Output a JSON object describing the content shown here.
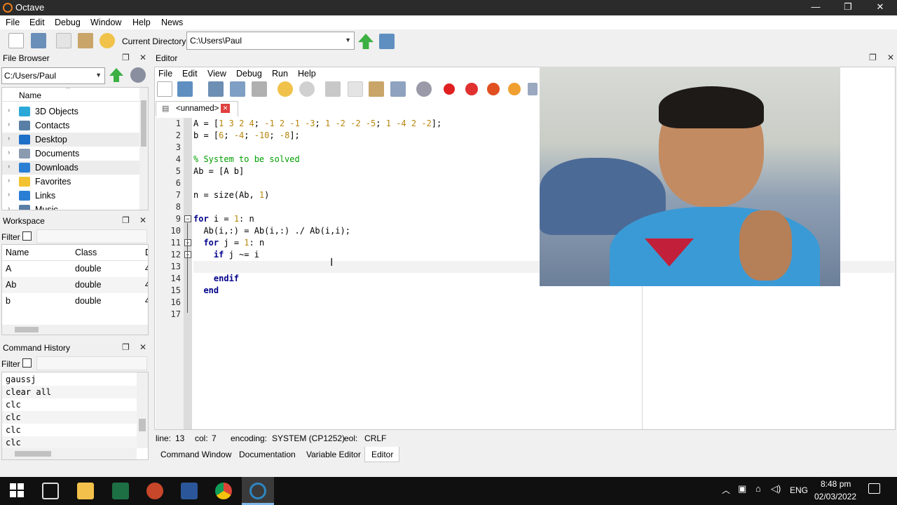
{
  "window": {
    "title": "Octave",
    "minimize": "—",
    "maximize": "❐",
    "close": "✕"
  },
  "menu": [
    "File",
    "Edit",
    "Debug",
    "Window",
    "Help",
    "News"
  ],
  "toolbar": {
    "current_dir_label": "Current Directory:",
    "current_dir_value": "C:\\Users\\Paul"
  },
  "file_browser": {
    "title": "File Browser",
    "path": "C:/Users/Paul",
    "column": "Name",
    "items": [
      {
        "label": "3D Objects",
        "icon": "3d-objects-icon",
        "color": "#2aa9d8"
      },
      {
        "label": "Contacts",
        "icon": "contacts-icon",
        "color": "#5a7fa6"
      },
      {
        "label": "Desktop",
        "icon": "desktop-icon",
        "color": "#1e6fc8"
      },
      {
        "label": "Documents",
        "icon": "documents-icon",
        "color": "#8a9bb0"
      },
      {
        "label": "Downloads",
        "icon": "downloads-icon",
        "color": "#2a7fd4"
      },
      {
        "label": "Favorites",
        "icon": "favorites-icon",
        "color": "#f2c230"
      },
      {
        "label": "Links",
        "icon": "links-icon",
        "color": "#2a7fd4"
      },
      {
        "label": "Music",
        "icon": "music-icon",
        "color": "#5a7fa6"
      }
    ]
  },
  "workspace": {
    "title": "Workspace",
    "filter_label": "Filter",
    "columns": [
      "Name",
      "Class",
      "D"
    ],
    "rows": [
      {
        "name": "A",
        "class": "double",
        "dim": "4"
      },
      {
        "name": "Ab",
        "class": "double",
        "dim": "4"
      },
      {
        "name": "b",
        "class": "double",
        "dim": "4"
      }
    ]
  },
  "history": {
    "title": "Command History",
    "filter_label": "Filter",
    "items": [
      "gaussj",
      "clear all",
      "clc",
      "clc",
      "clc",
      "clc"
    ]
  },
  "editor": {
    "title": "Editor",
    "menu": [
      "File",
      "Edit",
      "View",
      "Debug",
      "Run",
      "Help"
    ],
    "tab": "<unnamed>",
    "line_numbers": [
      "1",
      "2",
      "3",
      "4",
      "5",
      "6",
      "7",
      "8",
      "9",
      "10",
      "11",
      "12",
      "13",
      "14",
      "15",
      "16",
      "17"
    ],
    "lines": [
      "A = [1 3 2 4; -1 2 -1 -3; 1 -2 -2 -5; 1 -4 2 -2];",
      "b = [6; -4; -10; -8];",
      "",
      "% System to be solved",
      "Ab = [A b]",
      "",
      "n = size(Ab, 1)",
      "",
      "for i = 1: n",
      "  Ab(i,:) = Ab(i,:) ./ Ab(i,i);",
      "  for j = 1: n",
      "    if j ~= i",
      "",
      "    endif",
      "  end",
      "",
      ""
    ]
  },
  "status": {
    "line_label": "line:",
    "line": "13",
    "col_label": "col:",
    "col": "7",
    "enc_label": "encoding:",
    "enc": "SYSTEM (CP1252)",
    "eol_label": "eol:",
    "eol": "CRLF"
  },
  "bottom_tabs": [
    "Command Window",
    "Documentation",
    "Variable Editor",
    "Editor"
  ],
  "taskbar": {
    "lang": "ENG",
    "time": "8:48 pm",
    "date": "02/03/2022"
  },
  "colors": {
    "titlebar": "#2b2b2b",
    "taskbar": "#101010",
    "keyword": "#00008b",
    "number": "#b8860b",
    "comment": "#00a000"
  }
}
